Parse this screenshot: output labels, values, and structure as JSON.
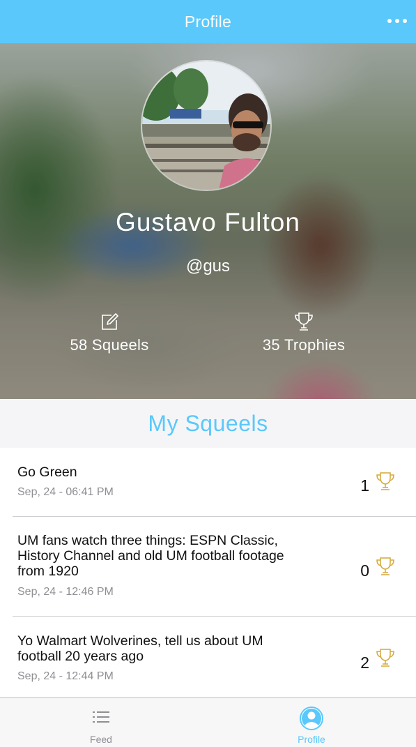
{
  "nav": {
    "title": "Profile",
    "more_icon": "more-dots-icon"
  },
  "profile": {
    "name": "Gustavo Fulton",
    "handle": "@gus",
    "stats": {
      "squeels_label": "58 Squeels",
      "trophies_label": "35 Trophies"
    }
  },
  "section": {
    "title": "My Squeels"
  },
  "squeels": [
    {
      "text": "Go Green",
      "date": "Sep, 24 - 06:41 PM",
      "trophies": "1"
    },
    {
      "text": "UM fans watch three things: ESPN Classic, History Channel and old UM football footage from 1920",
      "date": "Sep, 24 - 12:46 PM",
      "trophies": "0"
    },
    {
      "text": "Yo Walmart Wolverines, tell us about UM football 20 years ago",
      "date": "Sep, 24 - 12:44 PM",
      "trophies": "2"
    }
  ],
  "tabbar": {
    "tabs": [
      {
        "label": "Feed",
        "icon": "list-icon",
        "active": false
      },
      {
        "label": "Profile",
        "icon": "user-icon",
        "active": true
      }
    ]
  },
  "colors": {
    "accent": "#5ac8fa",
    "trophy": "#d4a93a",
    "secondary_text": "#8e8e93"
  }
}
